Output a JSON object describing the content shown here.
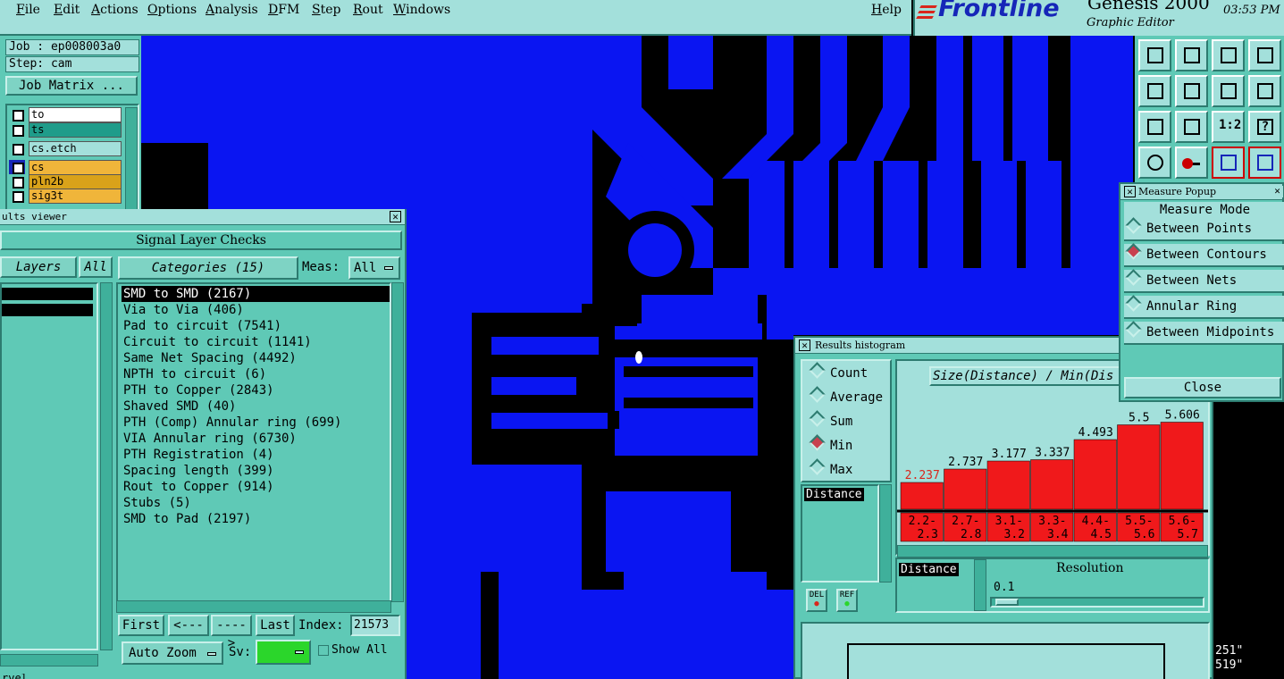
{
  "menu": [
    "File",
    "Edit",
    "Actions",
    "Options",
    "Analysis",
    "DFM",
    "Step",
    "Rout",
    "Windows"
  ],
  "help": "Help",
  "brand": {
    "logo": "Frontline",
    "product": "Genesis 2000",
    "subtitle": "Graphic Editor",
    "time": "03:53 PM"
  },
  "job": {
    "job_label": "Job : ep008003a0",
    "step_label": "Step: cam",
    "matrix_button": "Job Matrix ..."
  },
  "layers": [
    {
      "name": "to",
      "bg": "#ffffff"
    },
    {
      "name": "ts",
      "bg": "#1f9c8a"
    },
    {
      "name": "cs.etch",
      "bg": "#a3e0db"
    },
    {
      "name": "cs",
      "bg": "#f0b53a"
    },
    {
      "name": "pln2b",
      "bg": "#d9a21a"
    },
    {
      "name": "sig3t",
      "bg": "#f0b53a"
    }
  ],
  "results_viewer": {
    "title": "ults viewer",
    "header": "Signal Layer Checks",
    "layers_tab": "Layers",
    "all_tab": "All",
    "categories_tab": "Categories (15)",
    "meas_label": "Meas:",
    "meas_value": "All",
    "categories": [
      "SMD to SMD (2167)",
      "Via to Via (406)",
      "Pad to circuit (7541)",
      "Circuit to circuit (1141)",
      "Same Net Spacing (4492)",
      "NPTH to circuit (6)",
      "PTH to Copper (2843)",
      "Shaved SMD (40)",
      "PTH (Comp) Annular ring (699)",
      "VIA Annular ring (6730)",
      "PTH Registration (4)",
      "Spacing length (399)",
      "Rout to Copper (914)",
      "Stubs (5)",
      "SMD to Pad (2197)"
    ],
    "nav": {
      "first": "First",
      "prev": "<----",
      "next": "---->",
      "last": "Last",
      "index_label": "Index:",
      "index_value": "21573"
    },
    "auto_zoom": "Auto Zoom",
    "sv_label": "Sv:",
    "show_all": "Show All",
    "bottom_left": "rvel"
  },
  "histogram": {
    "title": "Results histogram",
    "modes": [
      "Count",
      "Average",
      "Sum",
      "Min",
      "Max"
    ],
    "selected_mode": "Min",
    "axis_title": "Size(Distance) / Min(Dis",
    "list_item": "Distance",
    "bars": [
      {
        "value": "2.237",
        "range": [
          "2.2-",
          "2.3"
        ],
        "h": 0.2
      },
      {
        "value": "2.737",
        "range": [
          "2.7-",
          "2.8"
        ],
        "h": 0.3
      },
      {
        "value": "3.177",
        "range": [
          "3.1-",
          "3.2"
        ],
        "h": 0.36
      },
      {
        "value": "3.337",
        "range": [
          "3.3-",
          "3.4"
        ],
        "h": 0.37
      },
      {
        "value": "4.493",
        "range": [
          "4.4-",
          "4.5"
        ],
        "h": 0.52
      },
      {
        "value": "5.5",
        "range": [
          "5.5-",
          "5.6"
        ],
        "h": 0.63
      },
      {
        "value": "5.606",
        "range": [
          "5.6-",
          "5.7"
        ],
        "h": 0.65
      }
    ],
    "distance_field": "Distance",
    "resolution_label": "Resolution",
    "resolution_value": "0.1",
    "del": "DEL",
    "ref": "REF"
  },
  "measure_popup": {
    "title": "Measure Popup",
    "mode_label": "Measure Mode",
    "options": [
      "Between Points",
      "Between Contours",
      "Between Nets",
      "Annular Ring",
      "Between Midpoints"
    ],
    "selected": "Between Contours",
    "close": "Close"
  },
  "coords": {
    "x": "251\"",
    "y": "519\""
  },
  "colors": {
    "copper": "#0a15f2",
    "panel": "#5fc9b6",
    "highlight": "#a3e0db",
    "bar": "#f0191b"
  }
}
